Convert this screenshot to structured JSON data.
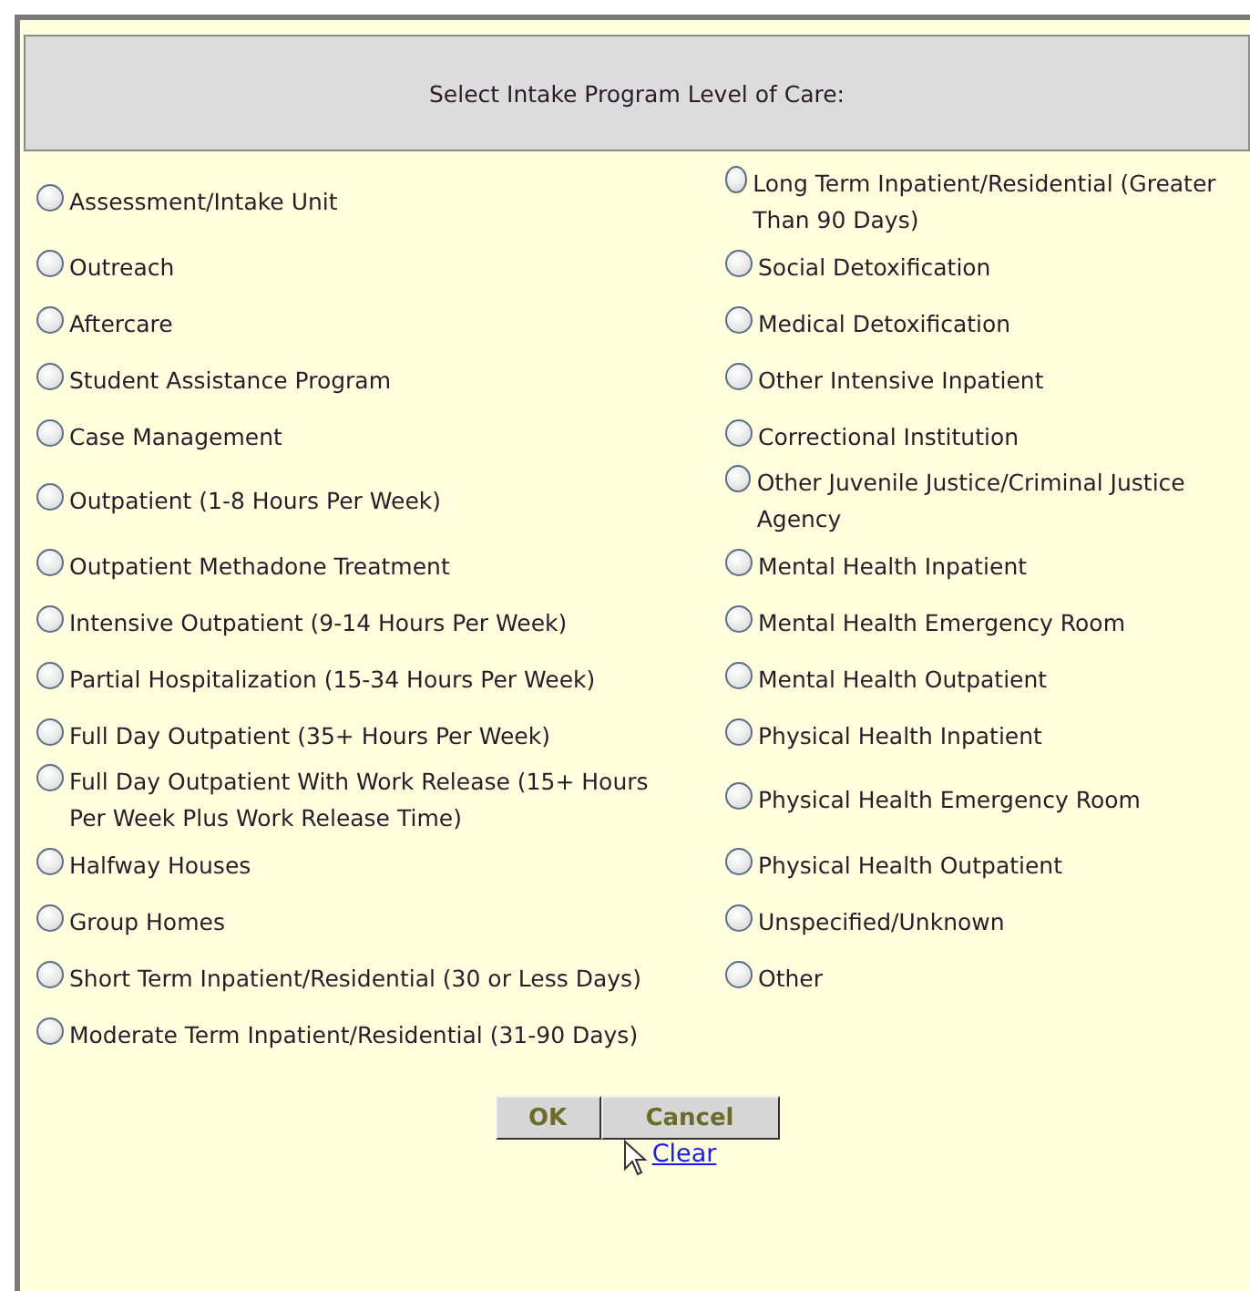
{
  "header": {
    "title": "Select Intake Program Level of Care:"
  },
  "rows": [
    {
      "left": {
        "label": "Assessment/Intake Unit",
        "selected": false
      },
      "right": {
        "label": "Long Term Inpatient/Residential (Greater Than 90 Days)",
        "selected": false
      }
    },
    {
      "left": {
        "label": "Outreach",
        "selected": false
      },
      "right": {
        "label": "Social Detoxification",
        "selected": false
      }
    },
    {
      "left": {
        "label": "Aftercare",
        "selected": false
      },
      "right": {
        "label": "Medical Detoxification",
        "selected": false
      }
    },
    {
      "left": {
        "label": "Student Assistance Program",
        "selected": false
      },
      "right": {
        "label": "Other Intensive Inpatient",
        "selected": false
      }
    },
    {
      "left": {
        "label": "Case Management",
        "selected": false
      },
      "right": {
        "label": "Correctional Institution",
        "selected": false
      }
    },
    {
      "left": {
        "label": "Outpatient (1-8 Hours Per Week)",
        "selected": false
      },
      "right": {
        "label": "Other Juvenile Justice/Criminal Justice Agency",
        "selected": false
      }
    },
    {
      "left": {
        "label": "Outpatient Methadone Treatment",
        "selected": false
      },
      "right": {
        "label": "Mental Health Inpatient",
        "selected": false
      }
    },
    {
      "left": {
        "label": "Intensive Outpatient (9-14 Hours Per Week)",
        "selected": false
      },
      "right": {
        "label": "Mental Health Emergency Room",
        "selected": false
      }
    },
    {
      "left": {
        "label": "Partial Hospitalization (15-34 Hours Per Week)",
        "selected": false
      },
      "right": {
        "label": "Mental Health Outpatient",
        "selected": false
      }
    },
    {
      "left": {
        "label": "Full Day Outpatient (35+ Hours Per Week)",
        "selected": false
      },
      "right": {
        "label": "Physical Health Inpatient",
        "selected": false
      }
    },
    {
      "left": {
        "label": "Full Day Outpatient With Work Release (15+ Hours Per Week Plus Work Release Time)",
        "selected": false
      },
      "right": {
        "label": "Physical Health Emergency Room",
        "selected": false
      }
    },
    {
      "left": {
        "label": "Halfway Houses",
        "selected": false
      },
      "right": {
        "label": "Physical Health Outpatient",
        "selected": false
      }
    },
    {
      "left": {
        "label": "Group Homes",
        "selected": false
      },
      "right": {
        "label": "Unspecified/Unknown",
        "selected": false
      }
    },
    {
      "left": {
        "label": "Short Term Inpatient/Residential (30 or Less Days)",
        "selected": false
      },
      "right": {
        "label": "Other",
        "selected": false
      }
    },
    {
      "left": {
        "label": "Moderate Term Inpatient/Residential (31-90 Days)",
        "selected": false
      }
    }
  ],
  "buttons": [
    "OK",
    "Cancel"
  ],
  "link": "Clear"
}
